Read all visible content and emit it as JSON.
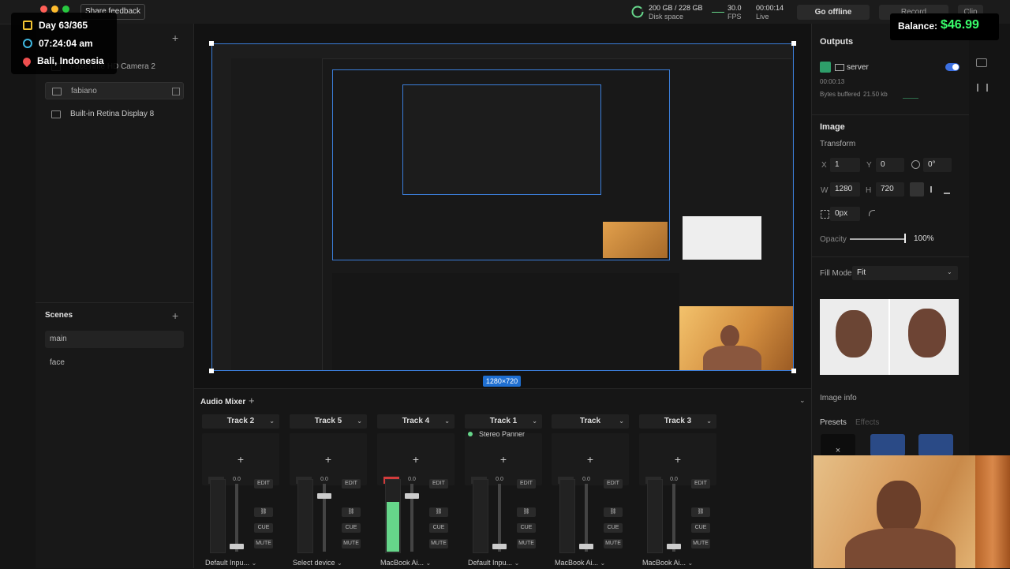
{
  "topbar": {
    "share_feedback": "Share feedback",
    "disk_space_value": "200 GB / 228 GB",
    "disk_space_label": "Disk space",
    "fps_value": "30.0",
    "fps_label": "FPS",
    "live_time": "00:00:14",
    "live_label": "Live",
    "go_offline": "Go offline",
    "record": "Record",
    "clip": "Clip"
  },
  "overlay": {
    "day": "Day 63/365",
    "time": "07:24:04 am",
    "location": "Bali, Indonesia",
    "balance_label": "Balance:",
    "balance_value": "$46.99"
  },
  "sources": {
    "items": [
      {
        "label": "FaceTime HD Camera 2"
      },
      {
        "label": "fabiano"
      },
      {
        "label": "Built-in Retina Display 8"
      }
    ]
  },
  "scenes": {
    "title": "Scenes",
    "items": [
      {
        "label": "main"
      },
      {
        "label": "face"
      }
    ]
  },
  "canvas": {
    "dims": "1280×720"
  },
  "mixer": {
    "title": "Audio Mixer",
    "add": "+",
    "tracks": [
      {
        "name": "Track 2",
        "level": "0.0",
        "fader": 0.05,
        "meter": 0,
        "select": "Default Inpu...",
        "edit": "EDIT",
        "cue": "CUE",
        "mute": "MUTE"
      },
      {
        "name": "Track 5",
        "level": "0.0",
        "fader": 0.85,
        "meter": 0,
        "select": "Select device",
        "edit": "EDIT",
        "cue": "CUE",
        "mute": "MUTE"
      },
      {
        "name": "Track 4",
        "level": "0.0",
        "fader": 0.85,
        "meter": 0.7,
        "select": "MacBook Ai...",
        "edit": "EDIT",
        "cue": "CUE",
        "mute": "MUTE"
      },
      {
        "name": "Track 1",
        "level": "0.0",
        "fader": 0.05,
        "meter": 0,
        "select": "Default Inpu...",
        "edit": "EDIT",
        "cue": "CUE",
        "mute": "MUTE",
        "panner": "Stereo Panner"
      },
      {
        "name": "Track",
        "level": "0.0",
        "fader": 0.05,
        "meter": 0,
        "select": "MacBook Ai...",
        "edit": "EDIT",
        "cue": "CUE",
        "mute": "MUTE"
      },
      {
        "name": "Track 3",
        "level": "0.0",
        "fader": 0.05,
        "meter": 0,
        "select": "MacBook Ai...",
        "edit": "EDIT",
        "cue": "CUE",
        "mute": "MUTE"
      }
    ]
  },
  "outputs": {
    "title": "Outputs",
    "server": "server",
    "time": "00:00:13",
    "bytes_label": "Bytes buffered",
    "bytes_value": "21.50 kb"
  },
  "image": {
    "title": "Image",
    "transform": "Transform",
    "x_label": "X",
    "x": "1",
    "y_label": "Y",
    "y": "0",
    "rot": "0°",
    "w_label": "W",
    "w": "1280",
    "h_label": "H",
    "h": "720",
    "radius": "0px",
    "opacity_label": "Opacity",
    "opacity": "100%",
    "fill_mode_label": "Fill Mode",
    "fill_mode": "Fit",
    "image_info": "Image info",
    "presets": "Presets",
    "effects": "Effects"
  },
  "colors": {
    "accent": "#3b7dd8",
    "green": "#66d68a",
    "balance": "#39ff6b"
  }
}
